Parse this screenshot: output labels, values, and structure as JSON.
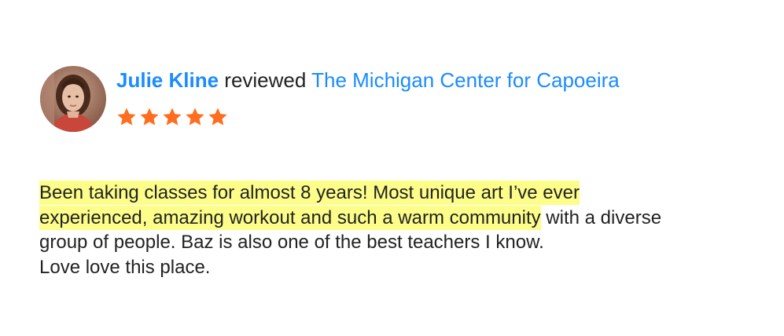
{
  "reviewer": {
    "name": "Julie Kline",
    "avatar_icon": "user-avatar-photo"
  },
  "action_word": "reviewed",
  "business": {
    "name": "The Michigan Center for Capoeira"
  },
  "rating": {
    "stars": 5,
    "max": 5,
    "star_color": "#ff6d1f"
  },
  "review": {
    "highlighted_line_1": "Been taking classes for almost 8 years! Most unique art I’ve ever",
    "highlighted_line_2": "experienced, amazing workout and such a warm community",
    "line_2_rest": " with a diverse",
    "line_3": "group of people. Baz is also one of the best teachers I know.",
    "line_4": "Love love this place."
  },
  "colors": {
    "link": "#1a8cff",
    "highlight": "#fdfd8a",
    "text": "#222222"
  }
}
